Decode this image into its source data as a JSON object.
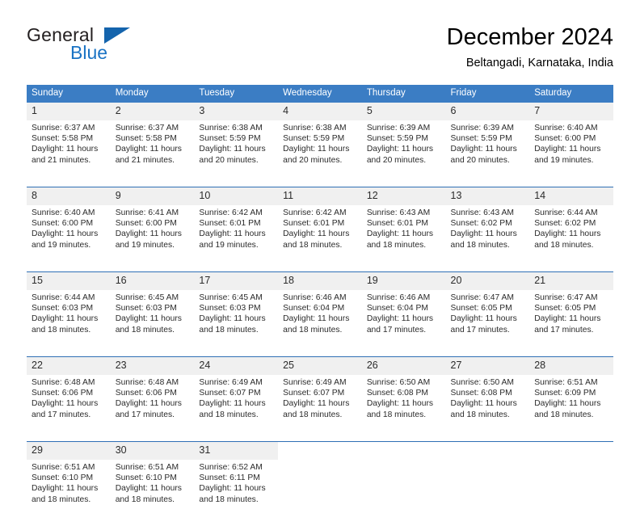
{
  "brand": {
    "name_part1": "General",
    "name_part2": "Blue",
    "logo_icon": "triangle-flag-icon",
    "accent_color": "#1464ad"
  },
  "header": {
    "title": "December 2024",
    "location": "Beltangadi, Karnataka, India"
  },
  "calendar": {
    "header_bg": "#3b7dc4",
    "separator_color": "#2f6fb5",
    "daynum_bg": "#f0f0f0",
    "weekdays": [
      "Sunday",
      "Monday",
      "Tuesday",
      "Wednesday",
      "Thursday",
      "Friday",
      "Saturday"
    ],
    "weeks": [
      [
        {
          "day": "1",
          "sunrise": "Sunrise: 6:37 AM",
          "sunset": "Sunset: 5:58 PM",
          "daylight_line1": "Daylight: 11 hours",
          "daylight_line2": "and 21 minutes."
        },
        {
          "day": "2",
          "sunrise": "Sunrise: 6:37 AM",
          "sunset": "Sunset: 5:58 PM",
          "daylight_line1": "Daylight: 11 hours",
          "daylight_line2": "and 21 minutes."
        },
        {
          "day": "3",
          "sunrise": "Sunrise: 6:38 AM",
          "sunset": "Sunset: 5:59 PM",
          "daylight_line1": "Daylight: 11 hours",
          "daylight_line2": "and 20 minutes."
        },
        {
          "day": "4",
          "sunrise": "Sunrise: 6:38 AM",
          "sunset": "Sunset: 5:59 PM",
          "daylight_line1": "Daylight: 11 hours",
          "daylight_line2": "and 20 minutes."
        },
        {
          "day": "5",
          "sunrise": "Sunrise: 6:39 AM",
          "sunset": "Sunset: 5:59 PM",
          "daylight_line1": "Daylight: 11 hours",
          "daylight_line2": "and 20 minutes."
        },
        {
          "day": "6",
          "sunrise": "Sunrise: 6:39 AM",
          "sunset": "Sunset: 5:59 PM",
          "daylight_line1": "Daylight: 11 hours",
          "daylight_line2": "and 20 minutes."
        },
        {
          "day": "7",
          "sunrise": "Sunrise: 6:40 AM",
          "sunset": "Sunset: 6:00 PM",
          "daylight_line1": "Daylight: 11 hours",
          "daylight_line2": "and 19 minutes."
        }
      ],
      [
        {
          "day": "8",
          "sunrise": "Sunrise: 6:40 AM",
          "sunset": "Sunset: 6:00 PM",
          "daylight_line1": "Daylight: 11 hours",
          "daylight_line2": "and 19 minutes."
        },
        {
          "day": "9",
          "sunrise": "Sunrise: 6:41 AM",
          "sunset": "Sunset: 6:00 PM",
          "daylight_line1": "Daylight: 11 hours",
          "daylight_line2": "and 19 minutes."
        },
        {
          "day": "10",
          "sunrise": "Sunrise: 6:42 AM",
          "sunset": "Sunset: 6:01 PM",
          "daylight_line1": "Daylight: 11 hours",
          "daylight_line2": "and 19 minutes."
        },
        {
          "day": "11",
          "sunrise": "Sunrise: 6:42 AM",
          "sunset": "Sunset: 6:01 PM",
          "daylight_line1": "Daylight: 11 hours",
          "daylight_line2": "and 18 minutes."
        },
        {
          "day": "12",
          "sunrise": "Sunrise: 6:43 AM",
          "sunset": "Sunset: 6:01 PM",
          "daylight_line1": "Daylight: 11 hours",
          "daylight_line2": "and 18 minutes."
        },
        {
          "day": "13",
          "sunrise": "Sunrise: 6:43 AM",
          "sunset": "Sunset: 6:02 PM",
          "daylight_line1": "Daylight: 11 hours",
          "daylight_line2": "and 18 minutes."
        },
        {
          "day": "14",
          "sunrise": "Sunrise: 6:44 AM",
          "sunset": "Sunset: 6:02 PM",
          "daylight_line1": "Daylight: 11 hours",
          "daylight_line2": "and 18 minutes."
        }
      ],
      [
        {
          "day": "15",
          "sunrise": "Sunrise: 6:44 AM",
          "sunset": "Sunset: 6:03 PM",
          "daylight_line1": "Daylight: 11 hours",
          "daylight_line2": "and 18 minutes."
        },
        {
          "day": "16",
          "sunrise": "Sunrise: 6:45 AM",
          "sunset": "Sunset: 6:03 PM",
          "daylight_line1": "Daylight: 11 hours",
          "daylight_line2": "and 18 minutes."
        },
        {
          "day": "17",
          "sunrise": "Sunrise: 6:45 AM",
          "sunset": "Sunset: 6:03 PM",
          "daylight_line1": "Daylight: 11 hours",
          "daylight_line2": "and 18 minutes."
        },
        {
          "day": "18",
          "sunrise": "Sunrise: 6:46 AM",
          "sunset": "Sunset: 6:04 PM",
          "daylight_line1": "Daylight: 11 hours",
          "daylight_line2": "and 18 minutes."
        },
        {
          "day": "19",
          "sunrise": "Sunrise: 6:46 AM",
          "sunset": "Sunset: 6:04 PM",
          "daylight_line1": "Daylight: 11 hours",
          "daylight_line2": "and 17 minutes."
        },
        {
          "day": "20",
          "sunrise": "Sunrise: 6:47 AM",
          "sunset": "Sunset: 6:05 PM",
          "daylight_line1": "Daylight: 11 hours",
          "daylight_line2": "and 17 minutes."
        },
        {
          "day": "21",
          "sunrise": "Sunrise: 6:47 AM",
          "sunset": "Sunset: 6:05 PM",
          "daylight_line1": "Daylight: 11 hours",
          "daylight_line2": "and 17 minutes."
        }
      ],
      [
        {
          "day": "22",
          "sunrise": "Sunrise: 6:48 AM",
          "sunset": "Sunset: 6:06 PM",
          "daylight_line1": "Daylight: 11 hours",
          "daylight_line2": "and 17 minutes."
        },
        {
          "day": "23",
          "sunrise": "Sunrise: 6:48 AM",
          "sunset": "Sunset: 6:06 PM",
          "daylight_line1": "Daylight: 11 hours",
          "daylight_line2": "and 17 minutes."
        },
        {
          "day": "24",
          "sunrise": "Sunrise: 6:49 AM",
          "sunset": "Sunset: 6:07 PM",
          "daylight_line1": "Daylight: 11 hours",
          "daylight_line2": "and 18 minutes."
        },
        {
          "day": "25",
          "sunrise": "Sunrise: 6:49 AM",
          "sunset": "Sunset: 6:07 PM",
          "daylight_line1": "Daylight: 11 hours",
          "daylight_line2": "and 18 minutes."
        },
        {
          "day": "26",
          "sunrise": "Sunrise: 6:50 AM",
          "sunset": "Sunset: 6:08 PM",
          "daylight_line1": "Daylight: 11 hours",
          "daylight_line2": "and 18 minutes."
        },
        {
          "day": "27",
          "sunrise": "Sunrise: 6:50 AM",
          "sunset": "Sunset: 6:08 PM",
          "daylight_line1": "Daylight: 11 hours",
          "daylight_line2": "and 18 minutes."
        },
        {
          "day": "28",
          "sunrise": "Sunrise: 6:51 AM",
          "sunset": "Sunset: 6:09 PM",
          "daylight_line1": "Daylight: 11 hours",
          "daylight_line2": "and 18 minutes."
        }
      ],
      [
        {
          "day": "29",
          "sunrise": "Sunrise: 6:51 AM",
          "sunset": "Sunset: 6:10 PM",
          "daylight_line1": "Daylight: 11 hours",
          "daylight_line2": "and 18 minutes."
        },
        {
          "day": "30",
          "sunrise": "Sunrise: 6:51 AM",
          "sunset": "Sunset: 6:10 PM",
          "daylight_line1": "Daylight: 11 hours",
          "daylight_line2": "and 18 minutes."
        },
        {
          "day": "31",
          "sunrise": "Sunrise: 6:52 AM",
          "sunset": "Sunset: 6:11 PM",
          "daylight_line1": "Daylight: 11 hours",
          "daylight_line2": "and 18 minutes."
        },
        {
          "day": "",
          "sunrise": "",
          "sunset": "",
          "daylight_line1": "",
          "daylight_line2": ""
        },
        {
          "day": "",
          "sunrise": "",
          "sunset": "",
          "daylight_line1": "",
          "daylight_line2": ""
        },
        {
          "day": "",
          "sunrise": "",
          "sunset": "",
          "daylight_line1": "",
          "daylight_line2": ""
        },
        {
          "day": "",
          "sunrise": "",
          "sunset": "",
          "daylight_line1": "",
          "daylight_line2": ""
        }
      ]
    ]
  }
}
